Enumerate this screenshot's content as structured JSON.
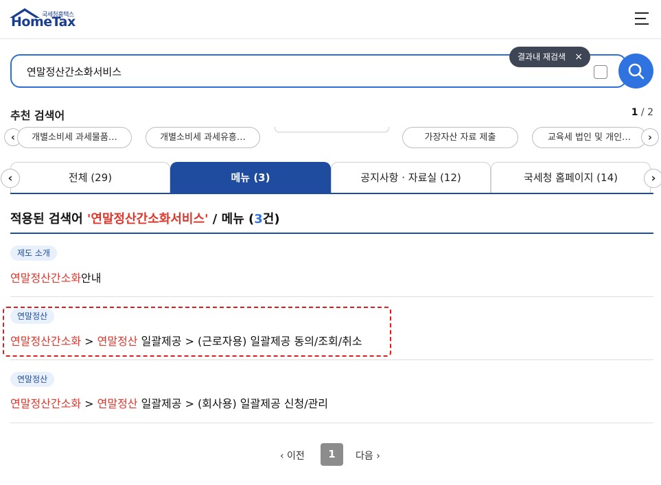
{
  "header": {
    "logo_sub": "국세청홈택스",
    "logo_main": "HomeTax"
  },
  "search": {
    "query": "연말정산간소화서비스",
    "tooltip_label": "결과내 재검색",
    "tooltip_close": "×"
  },
  "recommend": {
    "title": "추천 검색어",
    "page_current": "1",
    "page_total": " / 2",
    "prev_glyph": "‹",
    "next_glyph": "›",
    "chips": [
      "개별소비세 과세물품…",
      "개별소비세 과세유흥…",
      "가장자산 자료 제출",
      "교육세 법인 및 개인…"
    ]
  },
  "tabs": {
    "prev_glyph": "‹",
    "next_glyph": "›",
    "items": [
      {
        "label": "전체 (29)"
      },
      {
        "label": "메뉴 (3)"
      },
      {
        "label": "공지사항 · 자료실 (12)"
      },
      {
        "label": "국세청 홈페이지 (14)"
      }
    ],
    "active_index": 1
  },
  "result_heading": {
    "prefix": "적용된 검색어 ",
    "term": "'연말정산간소화서비스'",
    "middle": " / 메뉴 (",
    "count": "3",
    "suffix": "건)"
  },
  "results": [
    {
      "badge": "제도 소개",
      "hl1": "연말정산간소화",
      "rest1": "안내",
      "sep": "",
      "hl2": "",
      "rest2": ""
    },
    {
      "badge": "연말정산",
      "hl1": "연말정산간소화",
      "rest1": "",
      "sep": " > ",
      "hl2": "연말정산",
      "rest2": " 일괄제공 > (근로자용) 일괄제공 동의/조회/취소"
    },
    {
      "badge": "연말정산",
      "hl1": "연말정산간소화",
      "rest1": "",
      "sep": " > ",
      "hl2": "연말정산",
      "rest2": " 일괄제공 > (회사용) 일괄제공 신청/관리"
    }
  ],
  "pagination": {
    "prev_label": "‹ 이전",
    "current": "1",
    "next_label": "다음 ›"
  },
  "colors": {
    "brand_blue": "#1f4c9e",
    "search_blue": "#2e73e0",
    "highlight_red": "#e0352b",
    "focus_red": "#e01b1b"
  }
}
